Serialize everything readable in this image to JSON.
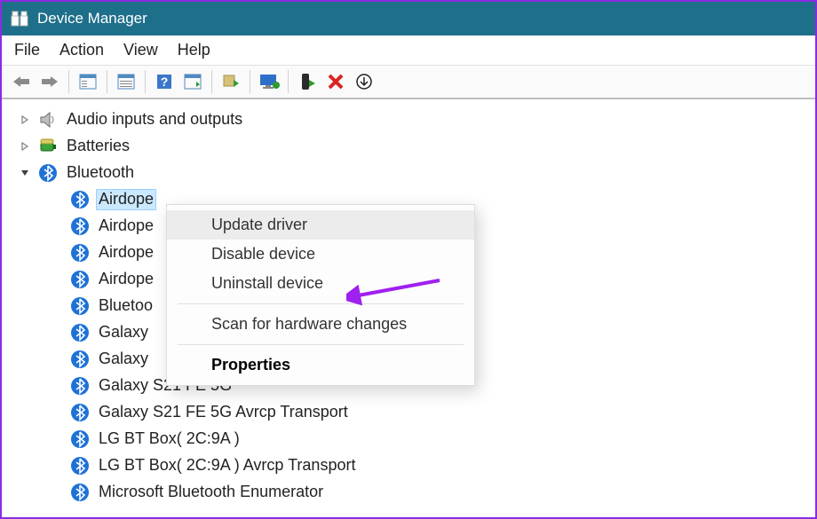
{
  "window": {
    "title": "Device Manager"
  },
  "menu": {
    "file": "File",
    "action": "Action",
    "view": "View",
    "help": "Help"
  },
  "tree": {
    "audio": "Audio inputs and outputs",
    "batteries": "Batteries",
    "bluetooth": "Bluetooth",
    "bt_items": [
      "Airdope",
      "Airdope",
      "Airdope",
      "Airdope",
      "Bluetoo",
      "Galaxy",
      "Galaxy",
      "Galaxy S21 FE 5G",
      "Galaxy S21 FE 5G Avrcp Transport",
      "LG BT Box( 2C:9A )",
      "LG BT Box( 2C:9A ) Avrcp Transport",
      "Microsoft Bluetooth Enumerator"
    ]
  },
  "context_menu": {
    "update": "Update driver",
    "disable": "Disable device",
    "uninstall": "Uninstall device",
    "scan": "Scan for hardware changes",
    "properties": "Properties"
  },
  "arrow_color": "#a020f0"
}
